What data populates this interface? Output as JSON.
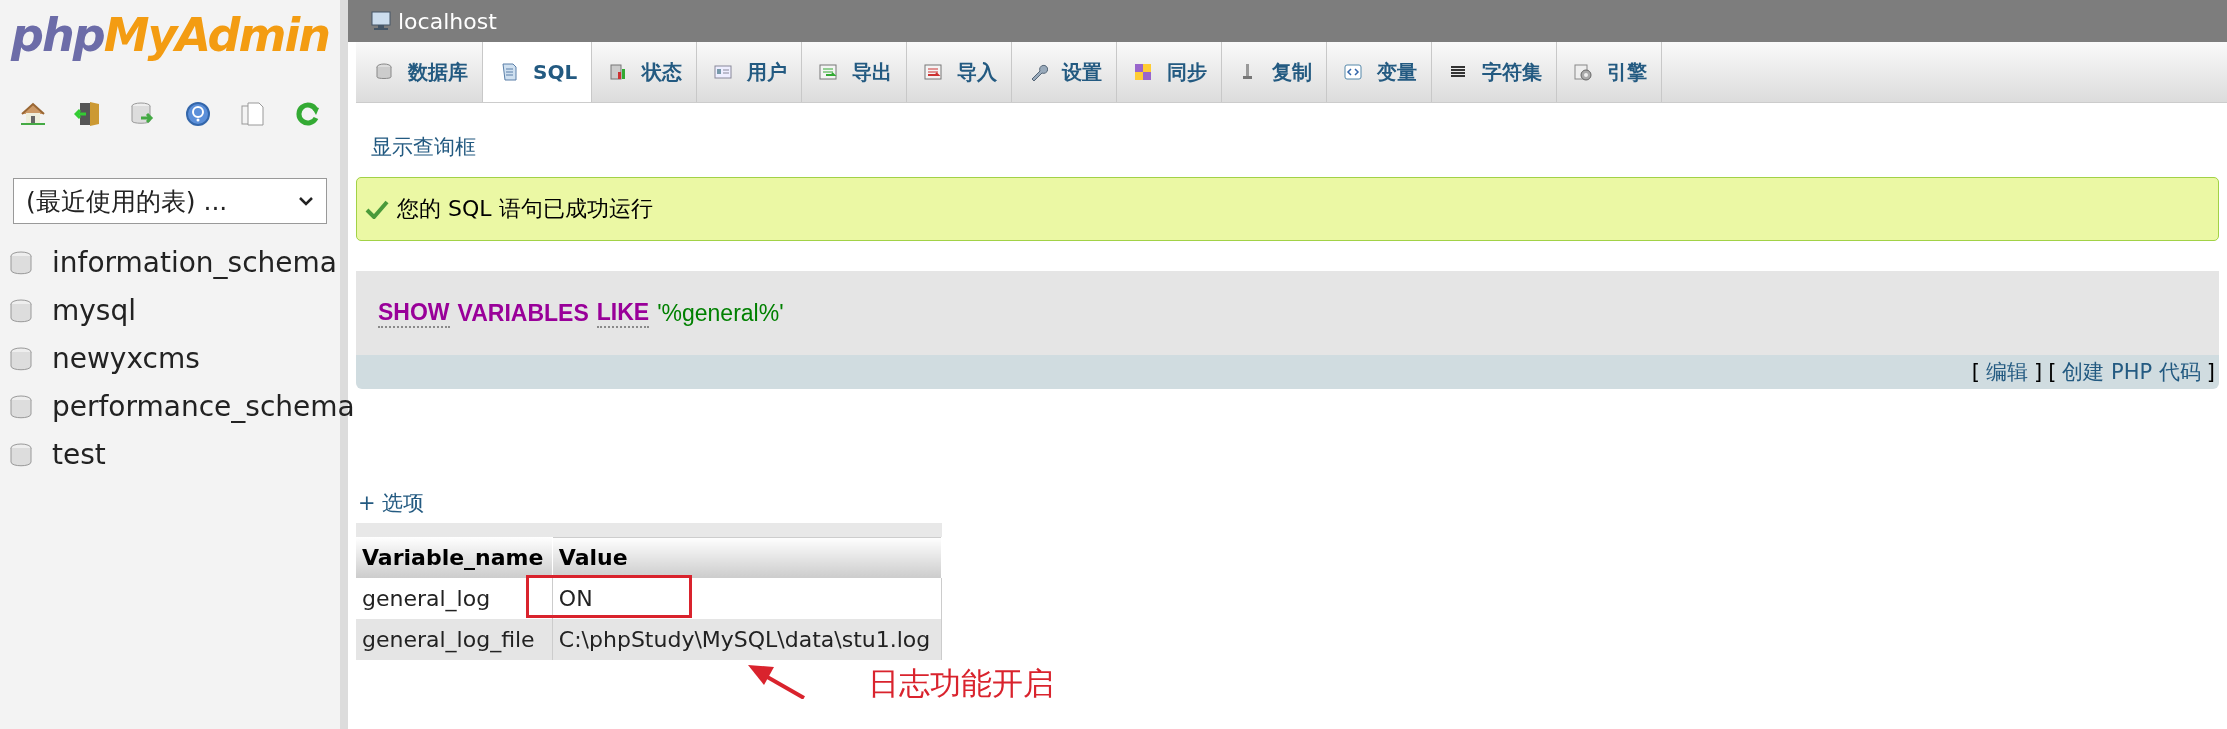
{
  "sidebar": {
    "logo": {
      "left": "php",
      "right": "MyAdmin"
    },
    "recent_select": {
      "value": "(最近使用的表) ..."
    },
    "databases": [
      {
        "name": "information_schema"
      },
      {
        "name": "mysql"
      },
      {
        "name": "newyxcms"
      },
      {
        "name": "performance_schema"
      },
      {
        "name": "test"
      }
    ]
  },
  "window": {
    "title": "localhost"
  },
  "tabs": [
    {
      "label": "数据库",
      "selected": false
    },
    {
      "label": "SQL",
      "selected": true
    },
    {
      "label": "状态",
      "selected": false
    },
    {
      "label": "用户",
      "selected": false
    },
    {
      "label": "导出",
      "selected": false
    },
    {
      "label": "导入",
      "selected": false
    },
    {
      "label": "设置",
      "selected": false
    },
    {
      "label": "同步",
      "selected": false
    },
    {
      "label": "复制",
      "selected": false
    },
    {
      "label": "变量",
      "selected": false
    },
    {
      "label": "字符集",
      "selected": false
    },
    {
      "label": "引擎",
      "selected": false
    }
  ],
  "show_query_link": "显示查询框",
  "success_message": "您的 SQL 语句已成功运行",
  "sql": [
    {
      "kind": "keyword",
      "text": "SHOW",
      "underline": true
    },
    {
      "kind": "keyword",
      "text": "VARIABLES",
      "underline": false
    },
    {
      "kind": "keyword",
      "text": "LIKE",
      "underline": true
    },
    {
      "kind": "string",
      "text": "'%general%'",
      "underline": false
    }
  ],
  "sql_actions": [
    {
      "open": "[",
      "label": "编辑",
      "close": "]"
    },
    {
      "open": "[",
      "label": "创建 PHP 代码",
      "close": "]"
    }
  ],
  "options_link": "+ 选项",
  "table": {
    "columns": [
      "Variable_name",
      "Value"
    ],
    "rows": [
      [
        "general_log",
        "ON"
      ],
      [
        "general_log_file",
        "C:\\phpStudy\\MySQL\\data\\stu1.log"
      ]
    ]
  },
  "annotation": {
    "text": "日志功能开启"
  }
}
